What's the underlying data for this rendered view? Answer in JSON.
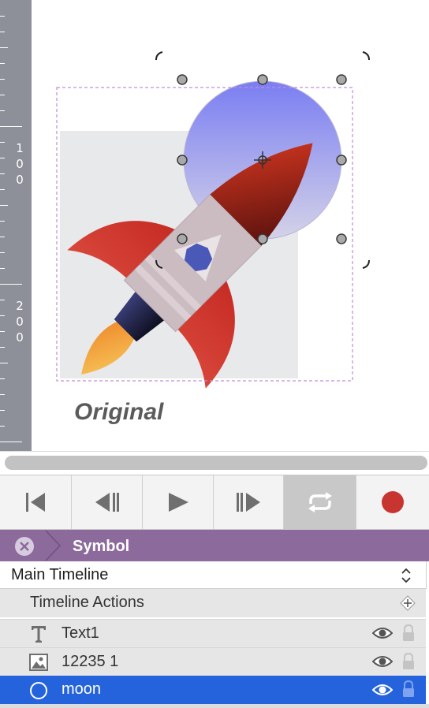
{
  "ruler": {
    "labels": [
      {
        "digits": [
          "1",
          "0",
          "0"
        ]
      },
      {
        "digits": [
          "2",
          "0",
          "0"
        ]
      }
    ]
  },
  "canvas": {
    "caption": "Original"
  },
  "transport": {
    "buttons": [
      {
        "icon": "skip-to-start-icon"
      },
      {
        "icon": "step-back-icon"
      },
      {
        "icon": "play-icon"
      },
      {
        "icon": "step-forward-icon"
      },
      {
        "icon": "loop-icon",
        "active": true
      },
      {
        "icon": "record-icon"
      }
    ]
  },
  "symbol_bar": {
    "title": "Symbol"
  },
  "timeline": {
    "selected": "Main Timeline"
  },
  "layers": {
    "actions_label": "Timeline Actions",
    "items": [
      {
        "name": "Text1",
        "icon": "text-icon"
      },
      {
        "name": "12235 1",
        "icon": "image-icon"
      },
      {
        "name": "moon",
        "icon": "ellipse-icon",
        "selected": true
      }
    ]
  },
  "colors": {
    "selection": "#2563dd",
    "symbol_bar": "#8c6a9b",
    "record": "#c8342f"
  }
}
